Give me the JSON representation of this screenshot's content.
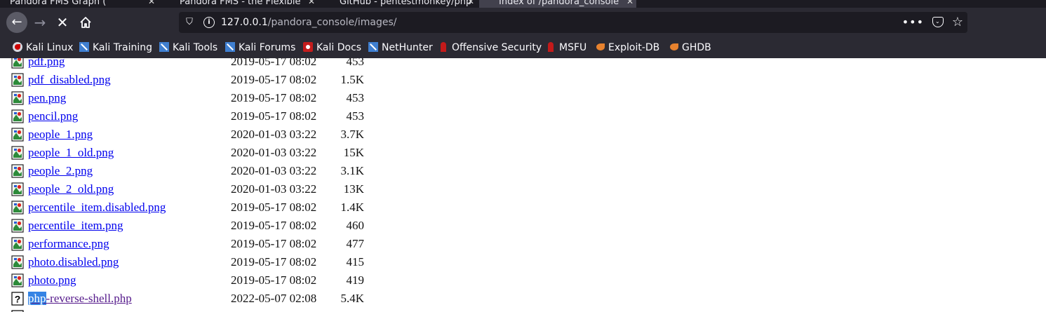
{
  "browser": {
    "tabs": [
      {
        "label": "Pandora FMS Graph (",
        "active": false
      },
      {
        "label": "Pandora FMS - the Flexible",
        "active": false
      },
      {
        "label": "GitHub - pentestmonkey/php",
        "active": false
      },
      {
        "label": "Index of /pandora_console",
        "active": true
      }
    ],
    "url_host": "127.0.0.1",
    "url_path": "/pandora_console/images/",
    "more_label": "•••",
    "bookmarks": [
      {
        "label": "Kali Linux",
        "icon": "kali-dragon-icon"
      },
      {
        "label": "Kali Training",
        "icon": "kali-training-icon"
      },
      {
        "label": "Kali Tools",
        "icon": "kali-tools-icon"
      },
      {
        "label": "Kali Forums",
        "icon": "kali-forums-icon"
      },
      {
        "label": "Kali Docs",
        "icon": "kali-docs-icon"
      },
      {
        "label": "NetHunter",
        "icon": "nethunter-icon"
      },
      {
        "label": "Offensive Security",
        "icon": "offsec-icon"
      },
      {
        "label": "MSFU",
        "icon": "msfu-icon"
      },
      {
        "label": "Exploit-DB",
        "icon": "exploit-db-icon"
      },
      {
        "label": "GHDB",
        "icon": "ghdb-icon"
      }
    ]
  },
  "listing": {
    "rows": [
      {
        "name": "pdf.png",
        "date": "2019-05-17 08:02",
        "size": "453",
        "type": "image"
      },
      {
        "name": "pdf_disabled.png",
        "date": "2019-05-17 08:02",
        "size": "1.5K",
        "type": "image"
      },
      {
        "name": "pen.png",
        "date": "2019-05-17 08:02",
        "size": "453",
        "type": "image"
      },
      {
        "name": "pencil.png",
        "date": "2019-05-17 08:02",
        "size": "453",
        "type": "image"
      },
      {
        "name": "people_1.png",
        "date": "2020-01-03 03:22",
        "size": "3.7K",
        "type": "image"
      },
      {
        "name": "people_1_old.png",
        "date": "2020-01-03 03:22",
        "size": "15K",
        "type": "image"
      },
      {
        "name": "people_2.png",
        "date": "2020-01-03 03:22",
        "size": "3.1K",
        "type": "image"
      },
      {
        "name": "people_2_old.png",
        "date": "2020-01-03 03:22",
        "size": "13K",
        "type": "image"
      },
      {
        "name": "percentile_item.disabled.png",
        "date": "2019-05-17 08:02",
        "size": "1.4K",
        "type": "image"
      },
      {
        "name": "percentile_item.png",
        "date": "2019-05-17 08:02",
        "size": "460",
        "type": "image"
      },
      {
        "name": "performance.png",
        "date": "2019-05-17 08:02",
        "size": "477",
        "type": "image"
      },
      {
        "name": "photo.disabled.png",
        "date": "2019-05-17 08:02",
        "size": "415",
        "type": "image"
      },
      {
        "name": "photo.png",
        "date": "2019-05-17 08:02",
        "size": "419",
        "type": "image"
      },
      {
        "name_selected": "php",
        "name_rest": "-reverse-shell.php",
        "date": "2022-05-07 02:08",
        "size": "5.4K",
        "type": "unknown",
        "visited": true
      }
    ]
  },
  "colors": {
    "chrome_bg": "#2b2a33",
    "urlbar_bg": "#1c1b22",
    "link": "#0000ee",
    "visited_link": "#551a8b",
    "selection": "#3584e4"
  }
}
